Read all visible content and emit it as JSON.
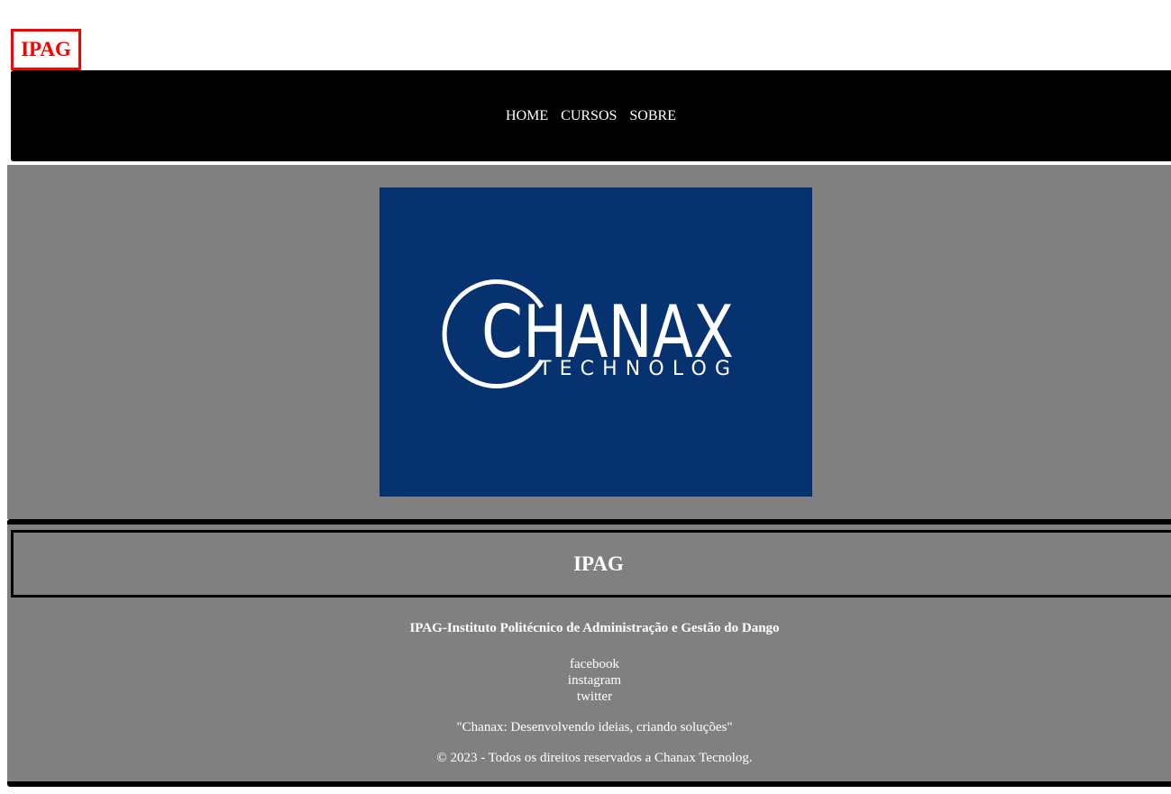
{
  "header": {
    "logo_text": "IPAG"
  },
  "nav": {
    "items": [
      {
        "label": "HOME"
      },
      {
        "label": "CURSOS"
      },
      {
        "label": "SOBRE"
      }
    ]
  },
  "hero": {
    "image_brand": "CHANAX",
    "image_sub": "TECHNOLOG",
    "image_color": "#06336f"
  },
  "footer": {
    "title": "IPAG",
    "institute": "IPAG-Instituto Politécnico de Administração e Gestão do Dango",
    "social": [
      "facebook",
      "instagram",
      "twitter"
    ],
    "slogan": "\"Chanax: Desenvolvendo ideias, criando soluções\"",
    "copyright": "© 2023 - Todos os direitos reservados a Chanax Tecnolog."
  }
}
